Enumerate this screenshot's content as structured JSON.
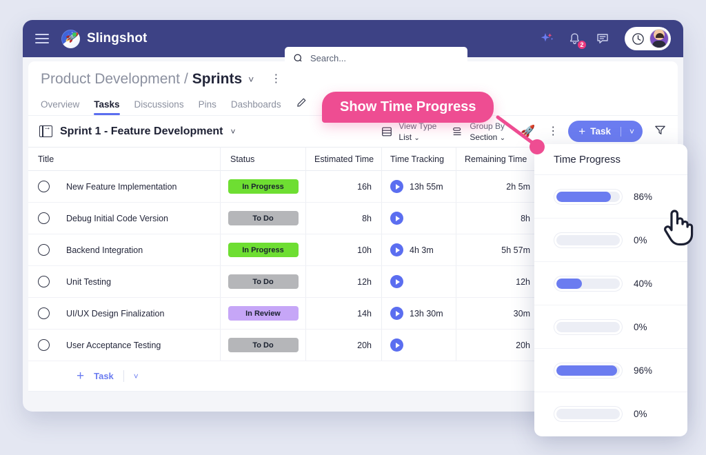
{
  "topbar": {
    "menu_icon": "hamburger-icon",
    "brand": "Slingshot",
    "search_placeholder": "Search...",
    "search_value": "",
    "search_icon": "search-icon",
    "ai_icon": "sparkle-icon",
    "notifications_icon": "bell-icon",
    "notifications_count": "2",
    "chat_icon": "chat-icon",
    "timer_icon": "clock-icon",
    "avatar": "user-avatar",
    "bg_color": "#3d4285"
  },
  "breadcrumb": {
    "parent": "Product Development",
    "separator": "/",
    "current": "Sprints",
    "chevron": "˅",
    "kebab": "⋮"
  },
  "tabs": [
    {
      "label": "Overview",
      "active": false
    },
    {
      "label": "Tasks",
      "active": true
    },
    {
      "label": "Discussions",
      "active": false
    },
    {
      "label": "Pins",
      "active": false
    },
    {
      "label": "Dashboards",
      "active": false
    }
  ],
  "edit_icon": "pencil-icon",
  "toolbar": {
    "sprint_title": "Sprint 1 - Feature Development",
    "sprint_chevron": "˅",
    "view_type_label": "View Type",
    "view_type_value": "List",
    "group_by_label": "Group By",
    "group_by_value": "Section",
    "rocket_icon": "rocket-icon",
    "kebab": "⋮",
    "add_task_label": "Task",
    "add_task_plus": "+",
    "add_task_chevron": "˅",
    "filter_icon": "funnel-icon",
    "accent_color": "#6b7cf0"
  },
  "table": {
    "columns": [
      "Title",
      "Status",
      "Estimated Time",
      "Time Tracking",
      "Remaining Time"
    ],
    "rows": [
      {
        "title": "New Feature Implementation",
        "status": "In Progress",
        "status_color": "#6ede32",
        "estimated": "16h",
        "tracked": "13h 55m",
        "remaining": "2h 5m"
      },
      {
        "title": "Debug Initial Code Version",
        "status": "To Do",
        "status_color": "#b5b6b9",
        "estimated": "8h",
        "tracked": "",
        "remaining": "8h"
      },
      {
        "title": "Backend Integration",
        "status": "In Progress",
        "status_color": "#6ede32",
        "estimated": "10h",
        "tracked": "4h 3m",
        "remaining": "5h 57m"
      },
      {
        "title": "Unit Testing",
        "status": "To Do",
        "status_color": "#b5b6b9",
        "estimated": "12h",
        "tracked": "",
        "remaining": "12h"
      },
      {
        "title": "UI/UX Design Finalization",
        "status": "In Review",
        "status_color": "#c6a6f7",
        "estimated": "14h",
        "tracked": "13h 30m",
        "remaining": "30m"
      },
      {
        "title": "User Acceptance Testing",
        "status": "To Do",
        "status_color": "#b5b6b9",
        "estimated": "20h",
        "tracked": "",
        "remaining": "20h"
      }
    ],
    "add_row_label": "Task",
    "add_row_plus": "+",
    "add_row_chevron": "˅"
  },
  "time_progress_panel": {
    "title": "Time Progress",
    "bar_color": "#6b7cf0",
    "rows": [
      {
        "percent_label": "86%",
        "percent": 86
      },
      {
        "percent_label": "0%",
        "percent": 0
      },
      {
        "percent_label": "40%",
        "percent": 40
      },
      {
        "percent_label": "0%",
        "percent": 0
      },
      {
        "percent_label": "96%",
        "percent": 96
      },
      {
        "percent_label": "0%",
        "percent": 0
      }
    ]
  },
  "callout": {
    "text": "Show Time Progress",
    "color": "#ee4d92"
  },
  "cursor": "pointing-hand-cursor"
}
